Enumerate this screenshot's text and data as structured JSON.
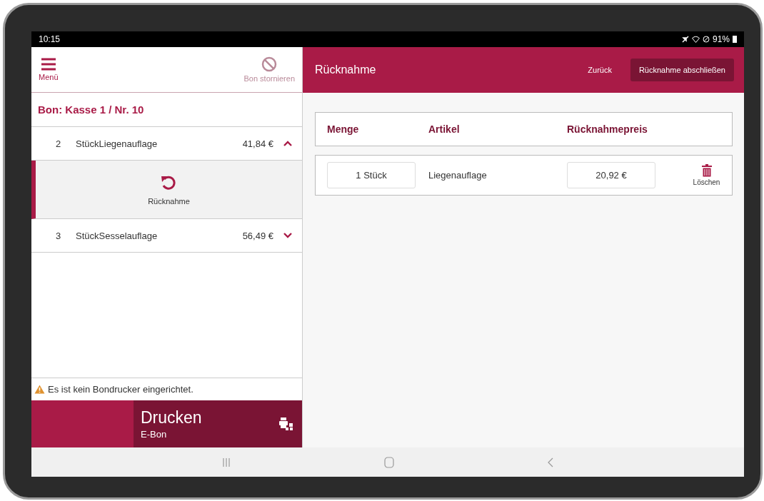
{
  "status_bar": {
    "time": "10:15",
    "battery": "91%"
  },
  "sidebar": {
    "menu": {
      "label": "Menü"
    },
    "cancel": {
      "label": "Bon stornieren",
      "disabled": true
    },
    "title": "Bon: Kasse 1 / Nr. 10",
    "items": [
      {
        "qty": "2",
        "name": "StückLiegenauflage",
        "price": "41,84 €",
        "expanded": true,
        "action": "Rücknahme"
      },
      {
        "qty": "3",
        "name": "StückSesselauflage",
        "price": "56,49 €",
        "expanded": false
      }
    ],
    "warning": "Es ist kein Bondrucker eingerichtet.",
    "print": {
      "title": "Drucken",
      "subtitle": "E-Bon"
    }
  },
  "main": {
    "title": "Rücknahme",
    "back": "Zurück",
    "finish": "Rücknahme abschließen",
    "columns": [
      "Menge",
      "Artikel",
      "Rücknahmepreis"
    ],
    "rows": [
      {
        "quantity": "1 Stück",
        "article": "Liegenauflage",
        "price": "20,92 €",
        "delete": "Löschen"
      }
    ]
  }
}
